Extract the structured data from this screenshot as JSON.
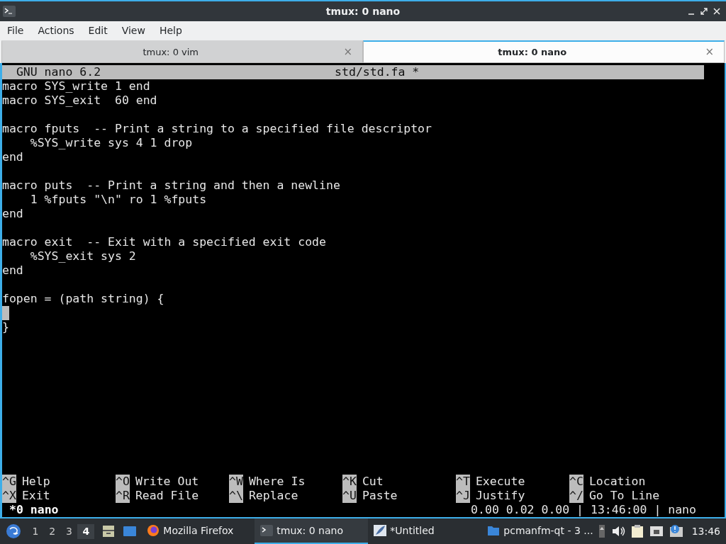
{
  "window": {
    "title": "tmux: 0 nano"
  },
  "menu": [
    "File",
    "Actions",
    "Edit",
    "View",
    "Help"
  ],
  "tabs": [
    {
      "label": "tmux: 0 vim",
      "close": "×",
      "selected": false
    },
    {
      "label": "tmux: 0 nano",
      "close": "×",
      "selected": true
    }
  ],
  "nano": {
    "version": "GNU nano 6.2",
    "filename": "std/std.fa *",
    "lines": [
      {
        "kind": "text",
        "text": "macro SYS_write 1 end"
      },
      {
        "kind": "text",
        "text": "macro SYS_exit  60 end"
      },
      {
        "kind": "blank"
      },
      {
        "kind": "text",
        "text": "macro fputs  -- Print a string to a specified file descriptor"
      },
      {
        "kind": "text",
        "text": "    %SYS_write sys 4 1 drop"
      },
      {
        "kind": "text",
        "text": "end"
      },
      {
        "kind": "blank"
      },
      {
        "kind": "text",
        "text": "macro puts  -- Print a string and then a newline"
      },
      {
        "kind": "text",
        "text": "    1 %fputs \"\\n\" ro 1 %fputs"
      },
      {
        "kind": "text",
        "text": "end"
      },
      {
        "kind": "blank"
      },
      {
        "kind": "text",
        "text": "macro exit  -- Exit with a specified exit code"
      },
      {
        "kind": "text",
        "text": "    %SYS_exit sys 2"
      },
      {
        "kind": "text",
        "text": "end"
      },
      {
        "kind": "blank"
      },
      {
        "kind": "text",
        "text": "fopen = (path string) {"
      },
      {
        "kind": "cursor"
      },
      {
        "kind": "text",
        "text": "}"
      }
    ],
    "shortcuts": [
      [
        {
          "key": "^G",
          "label": "Help"
        },
        {
          "key": "^O",
          "label": "Write Out"
        },
        {
          "key": "^W",
          "label": "Where Is"
        },
        {
          "key": "^K",
          "label": "Cut"
        },
        {
          "key": "^T",
          "label": "Execute"
        },
        {
          "key": "^C",
          "label": "Location"
        }
      ],
      [
        {
          "key": "^X",
          "label": "Exit"
        },
        {
          "key": "^R",
          "label": "Read File"
        },
        {
          "key": "^\\",
          "label": "Replace"
        },
        {
          "key": "^U",
          "label": "Paste"
        },
        {
          "key": "^J",
          "label": "Justify"
        },
        {
          "key": "^/",
          "label": "Go To Line"
        }
      ]
    ]
  },
  "tmux_status": {
    "window": "*0 nano",
    "right": "0.00 0.02 0.00 | 13:46:00 | nano"
  },
  "taskbar": {
    "workspaces": [
      {
        "label": "1",
        "selected": false
      },
      {
        "label": "2",
        "selected": false
      },
      {
        "label": "3",
        "selected": false
      },
      {
        "label": "4",
        "selected": true
      }
    ],
    "tasks": [
      {
        "kind": "firefox",
        "label": "Mozilla Firefox",
        "selected": false
      },
      {
        "kind": "terminal",
        "label": "tmux: 0 nano",
        "selected": true
      },
      {
        "kind": "editor",
        "label": "*Untitled",
        "selected": false
      },
      {
        "kind": "folder",
        "label": "pcmanfm-qt - 3 ...",
        "selected": false
      }
    ],
    "clock": "13:46"
  }
}
